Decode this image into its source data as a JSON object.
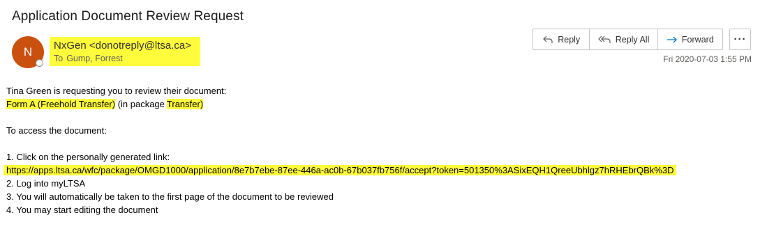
{
  "email": {
    "subject": "Application Document Review Request",
    "avatar_initial": "N",
    "sender": "NxGen <donotreply@ltsa.ca>",
    "to_label": "To",
    "to_name": "Gump, Forrest",
    "date": "Fri 2020-07-03 1:55 PM"
  },
  "actions": {
    "reply": "Reply",
    "reply_all": "Reply All",
    "forward": "Forward",
    "more": "···"
  },
  "message": {
    "line1": "Tina Green is requesting you to review their document:",
    "doc_name": "Form A (Freehold Transfer)",
    "in_package": "(in package",
    "package_name": "Transfer)",
    "access": "To access the document:",
    "step1": "1.  Click on the personally generated link:",
    "link": "https://apps.ltsa.ca/wfc/package/OMGD1000/application/8e7b7ebe-87ee-446a-ac0b-67b037fb756f/accept?token=501350%3ASixEQH1QreeUbhlgz7hRHEbrQBk%3D",
    "step2": "2.  Log into myLTSA",
    "step3": "3.  You will automatically be taken to the first page of the document to be reviewed",
    "step4": "4.  You may start editing the document"
  },
  "colors": {
    "highlight": "#fffc3c",
    "avatar_bg": "#ca5010",
    "accent": "#0078d4"
  }
}
